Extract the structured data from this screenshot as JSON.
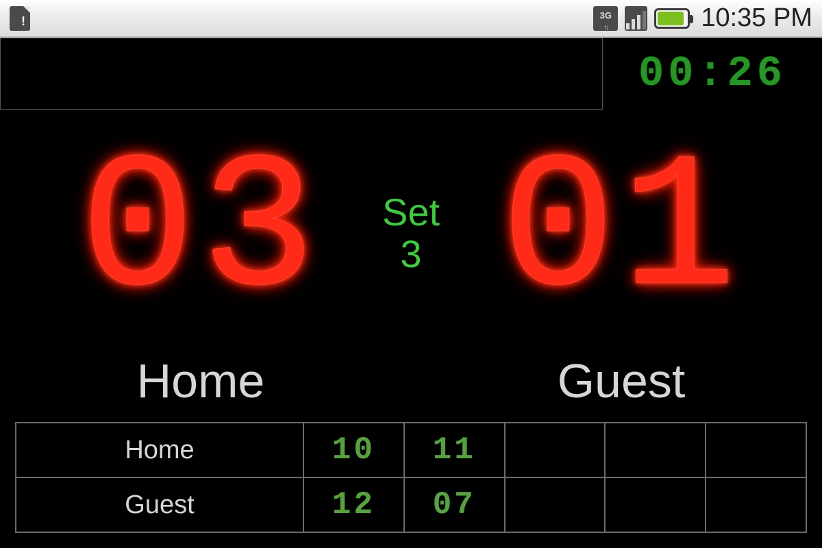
{
  "status_bar": {
    "clock": "10:35 PM",
    "network_label": "3G"
  },
  "timer": {
    "display": "00:26"
  },
  "set": {
    "label": "Set",
    "number": "3"
  },
  "scores": {
    "home": "03",
    "guest": "01"
  },
  "teams": {
    "home_label": "Home",
    "guest_label": "Guest"
  },
  "set_history": {
    "columns": 5,
    "home_label": "Home",
    "guest_label": "Guest",
    "home": [
      "10",
      "11",
      "",
      "",
      ""
    ],
    "guest": [
      "12",
      "07",
      "",
      "",
      ""
    ]
  }
}
